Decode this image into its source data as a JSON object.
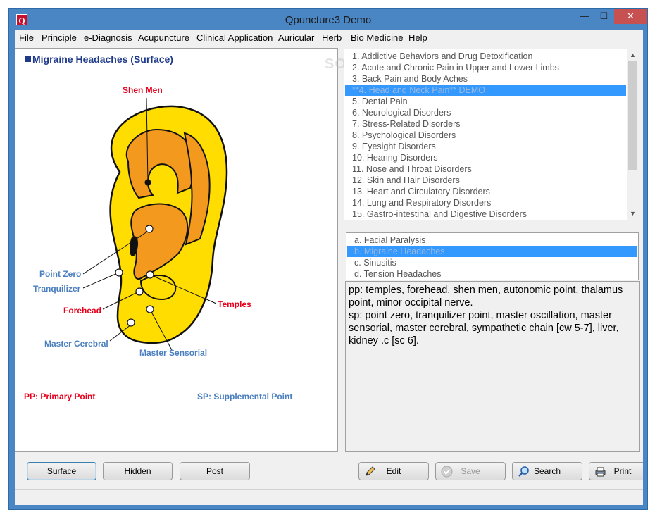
{
  "window": {
    "title": "Qpuncture3 Demo",
    "icon_letter": "Q",
    "controls": {
      "minimize": "—",
      "maximize": "☐",
      "close": "✕"
    }
  },
  "menu": [
    "File",
    "Principle",
    "e-Diagnosis",
    "Acupuncture",
    "Clinical Application",
    "Auricular",
    "Herb",
    "Bio Medicine",
    "Help"
  ],
  "left_panel": {
    "heading": "Migraine Headaches (Surface)",
    "labels": {
      "shen_men": "Shen Men",
      "point_zero": "Point Zero",
      "tranquilizer": "Tranquilizer",
      "forehead": "Forehead",
      "temples": "Temples",
      "master_cerebral": "Master Cerebral",
      "master_sensorial": "Master Sensorial",
      "pp_legend": "PP: Primary Point",
      "sp_legend": "SP: Supplemental Point"
    },
    "colors": {
      "primary_label": "#e8001c",
      "supplemental_label": "#4a7fc0",
      "ear_fill": "#ffdd00",
      "ear_inner": "#f39a1e"
    }
  },
  "watermark": "SOFTPEDIA",
  "conditions_list": {
    "items": [
      "1. Addictive Behaviors and Drug Detoxification",
      "2. Acute and Chronic Pain in Upper and Lower Limbs",
      "3. Back Pain and Body Aches",
      "**4. Head and Neck Pain** DEMO",
      "5. Dental Pain",
      "6. Neurological Disorders",
      "7. Stress-Related Disorders",
      "8. Psychological Disorders",
      "9. Eyesight Disorders",
      "10. Hearing Disorders",
      "11. Nose and Throat Disorders",
      "12. Skin and Hair Disorders",
      "13. Heart and Circulatory Disorders",
      "14. Lung and Respiratory Disorders",
      "15. Gastro-intestinal and Digestive Disorders"
    ],
    "selected_index": 3
  },
  "sub_list": {
    "items": [
      "a.  Facial Paralysis",
      "b.  Migraine Headaches",
      "c.  Sinusitis",
      "d.  Tension Headaches"
    ],
    "selected_index": 1
  },
  "details": {
    "pp": "pp:  temples, forehead, shen men, autonomic point, thalamus point, minor occipital nerve.",
    "sp": "sp:  point zero, tranquilizer point, master oscillation, master sensorial, master cerebral, sympathetic chain [cw 5-7], liver, kidney .c [sc 6]."
  },
  "buttons": {
    "surface": "Surface",
    "hidden": "Hidden",
    "post": "Post",
    "edit": "Edit",
    "save": "Save",
    "search": "Search",
    "print": "Print"
  },
  "icons": {
    "edit": "pencil-icon",
    "save": "checkmark-icon",
    "search": "magnifier-icon",
    "print": "printer-icon"
  }
}
